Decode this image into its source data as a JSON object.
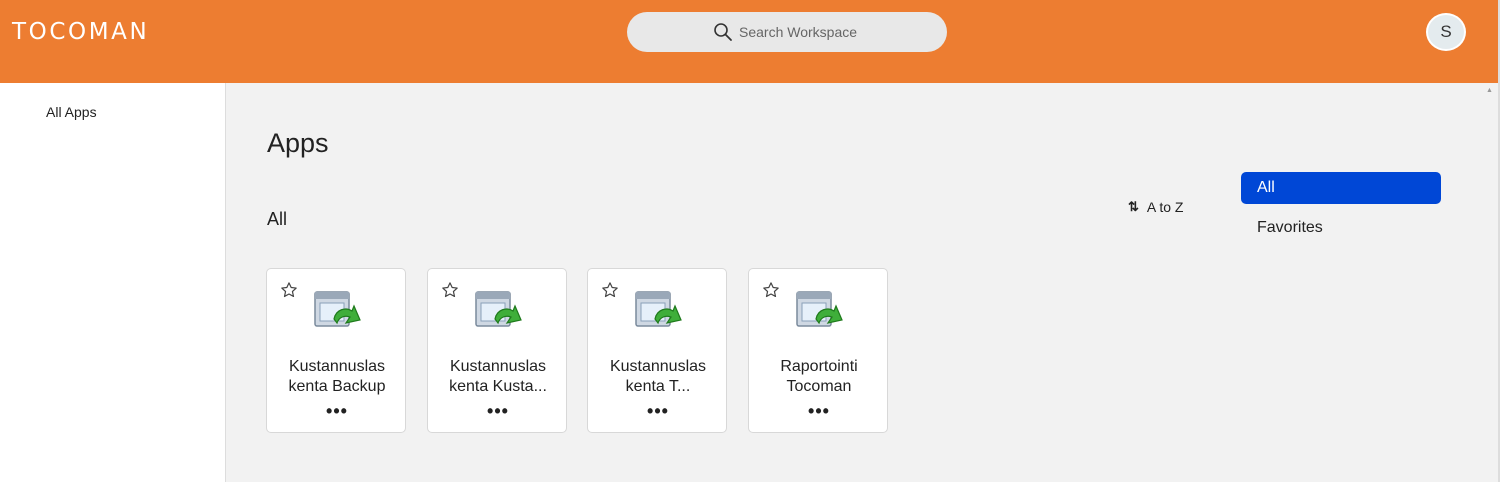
{
  "header": {
    "logo": "TOCOMAN",
    "search_placeholder": "Search Workspace",
    "avatar_initial": "S",
    "brand_color": "#ed7d31"
  },
  "sidebar": {
    "items": [
      {
        "label": "All Apps"
      }
    ]
  },
  "main": {
    "title": "Apps",
    "section": "All",
    "sort_label": "A to Z",
    "filters": [
      {
        "label": "All",
        "selected": true
      },
      {
        "label": "Favorites",
        "selected": false
      }
    ],
    "apps": [
      {
        "name_line1": "Kustannuslas",
        "name_line2": "kenta Backup",
        "icon": "app-window-arrow-icon"
      },
      {
        "name_line1": "Kustannuslas",
        "name_line2": "kenta Kusta...",
        "icon": "app-window-arrow-icon"
      },
      {
        "name_line1": "Kustannuslas",
        "name_line2": "kenta T...",
        "icon": "app-window-arrow-icon"
      },
      {
        "name_line1": "Raportointi",
        "name_line2": "Tocoman",
        "icon": "app-window-arrow-icon"
      }
    ],
    "more_label": "•••"
  },
  "colors": {
    "accent": "#0047d6"
  }
}
